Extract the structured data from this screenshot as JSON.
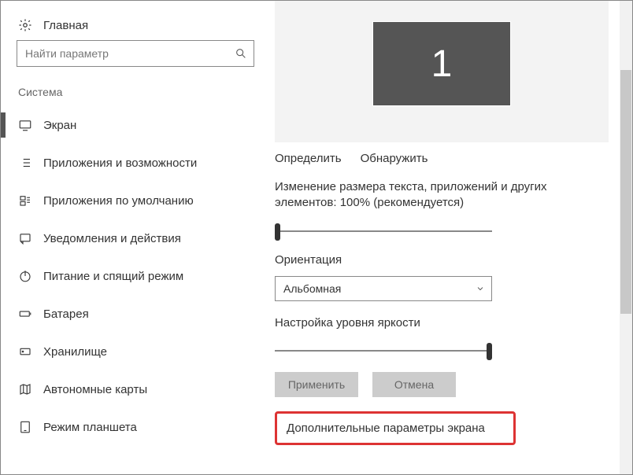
{
  "sidebar": {
    "home": "Главная",
    "search_placeholder": "Найти параметр",
    "category": "Система",
    "items": [
      {
        "label": "Экран"
      },
      {
        "label": "Приложения и возможности"
      },
      {
        "label": "Приложения по умолчанию"
      },
      {
        "label": "Уведомления и действия"
      },
      {
        "label": "Питание и спящий режим"
      },
      {
        "label": "Батарея"
      },
      {
        "label": "Хранилище"
      },
      {
        "label": "Автономные карты"
      },
      {
        "label": "Режим планшета"
      }
    ]
  },
  "main": {
    "monitor_number": "1",
    "identify": "Определить",
    "detect": "Обнаружить",
    "scale_label": "Изменение размера текста, приложений и других элементов: 100% (рекомендуется)",
    "orientation_label": "Ориентация",
    "orientation_value": "Альбомная",
    "brightness_label": "Настройка уровня яркости",
    "apply": "Применить",
    "cancel": "Отмена",
    "advanced": "Дополнительные параметры экрана"
  }
}
